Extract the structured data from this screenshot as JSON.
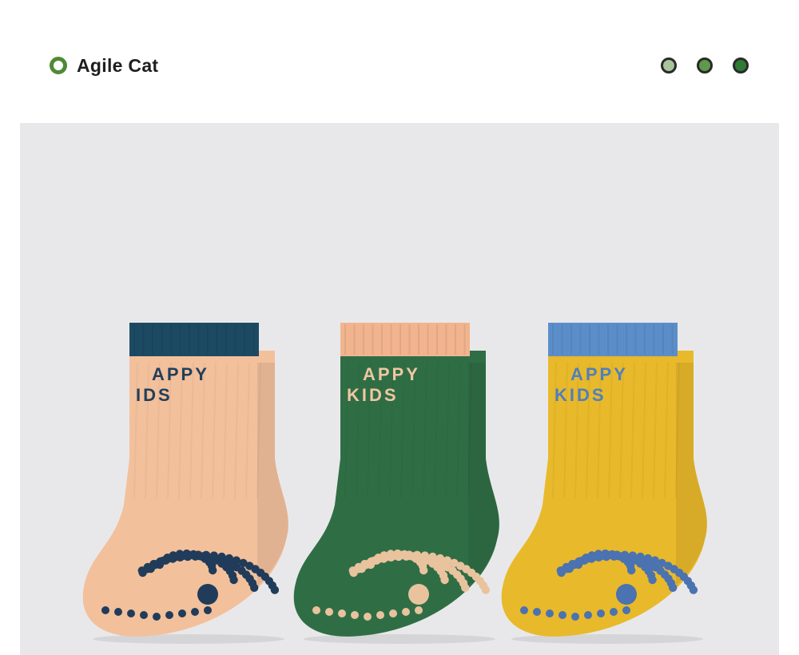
{
  "brand": {
    "name": "Agile Cat",
    "ring_color": "#4f8a35"
  },
  "color_dots": [
    "#a8c49a",
    "#5d9a4a",
    "#2f7a35"
  ],
  "product": {
    "socks": [
      {
        "body": "#f3c09c",
        "cuff": "#1d4a63",
        "text": "#213f5a",
        "dots": "#203c5a",
        "line1": "APPY",
        "line2": "IDS"
      },
      {
        "body": "#2f6e45",
        "cuff": "#f1b48e",
        "text": "#efc7a2",
        "dots": "#e9c39e",
        "line1": "APPY",
        "line2": "KIDS"
      },
      {
        "body": "#e8b92a",
        "cuff": "#5b8ec9",
        "text": "#4f7fbe",
        "dots": "#4b72b1",
        "line1": "APPY",
        "line2": "KIDS"
      }
    ]
  }
}
